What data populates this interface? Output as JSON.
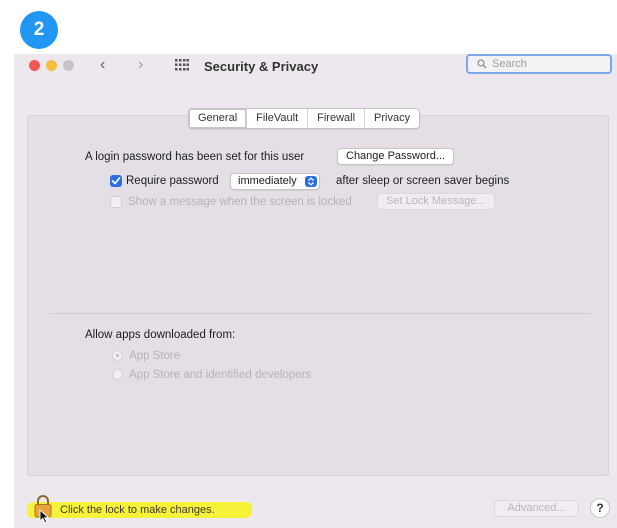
{
  "step_badge": "2",
  "window": {
    "title": "Security & Privacy",
    "search": {
      "placeholder": "Search"
    }
  },
  "tabs": [
    {
      "label": "General",
      "active": true
    },
    {
      "label": "FileVault",
      "active": false
    },
    {
      "label": "Firewall",
      "active": false
    },
    {
      "label": "Privacy",
      "active": false
    }
  ],
  "general": {
    "login_text": "A login password has been set for this user",
    "change_password_label": "Change Password...",
    "require_password": {
      "checked": true,
      "label": "Require password",
      "delay_value": "immediately",
      "after_text": "after sleep or screen saver begins"
    },
    "show_message": {
      "checked": false,
      "label": "Show a message when the screen is locked",
      "button_label": "Set Lock Message..."
    },
    "allow_apps": {
      "heading": "Allow apps downloaded from:",
      "options": [
        {
          "label": "App Store",
          "selected": true
        },
        {
          "label": "App Store and identified developers",
          "selected": false
        }
      ]
    }
  },
  "bottom": {
    "lock_label": "Click the lock to make changes.",
    "advanced_label": "Advanced...",
    "help_label": "?"
  },
  "colors": {
    "accent": "#2e6fe0",
    "badge": "#2196f3",
    "highlight": "#f6f23a",
    "lock": "#e8a33a"
  }
}
